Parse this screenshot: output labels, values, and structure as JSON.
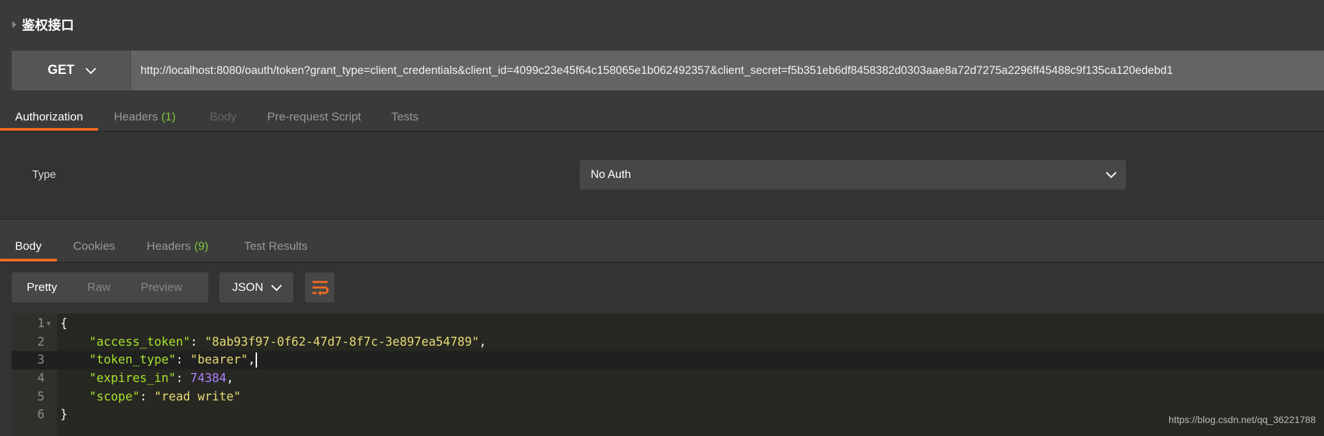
{
  "request": {
    "title": "鉴权接口",
    "method": "GET",
    "url": "http://localhost:8080/oauth/token?grant_type=client_credentials&client_id=4099c23e45f64c158065e1b062492357&client_secret=f5b351eb6df8458382d0303aae8a72d7275a2296ff45488c9f135ca120edebd1"
  },
  "request_tabs": [
    {
      "label": "Authorization"
    },
    {
      "label": "Headers",
      "count": "(1)"
    },
    {
      "label": "Body"
    },
    {
      "label": "Pre-request Script"
    },
    {
      "label": "Tests"
    }
  ],
  "auth": {
    "type_label": "Type",
    "type_value": "No Auth"
  },
  "response_tabs": [
    {
      "label": "Body"
    },
    {
      "label": "Cookies"
    },
    {
      "label": "Headers",
      "count": "(9)"
    },
    {
      "label": "Test Results"
    }
  ],
  "view_modes": [
    "Pretty",
    "Raw",
    "Preview"
  ],
  "format": "JSON",
  "code": {
    "lines": [
      "1",
      "2",
      "3",
      "4",
      "5",
      "6"
    ],
    "open": "{",
    "close": "}",
    "k1": "\"access_token\"",
    "v1": "\"8ab93f97-0f62-47d7-8f7c-3e897ea54789\"",
    "k2": "\"token_type\"",
    "v2": "\"bearer\"",
    "k3": "\"expires_in\"",
    "v3": "74384",
    "k4": "\"scope\"",
    "v4": "\"read write\""
  },
  "watermark": "https://blog.csdn.net/qq_36221788",
  "colors": {
    "accent": "#f26b21",
    "count": "#7ec33d",
    "json_key": "#a6e22e",
    "json_string": "#e6db74",
    "json_number": "#ae81ff"
  }
}
